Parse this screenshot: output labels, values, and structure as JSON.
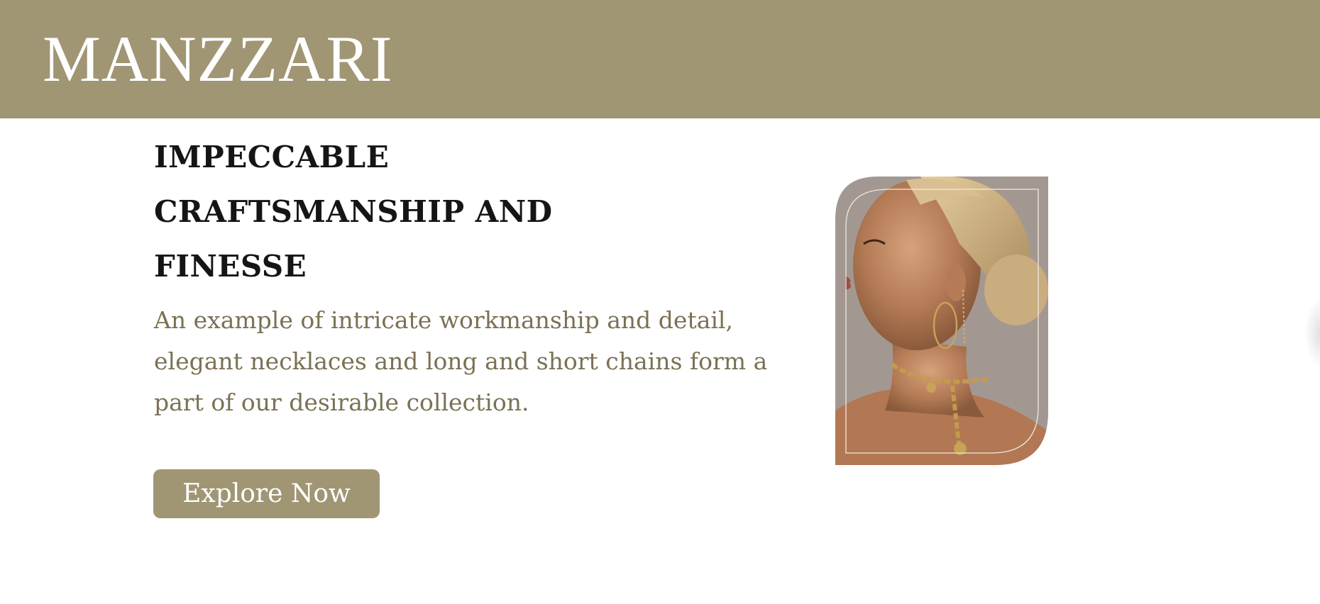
{
  "brand": {
    "logo_text": "MANZZARI",
    "header_color": "#a09674"
  },
  "hero": {
    "headline_lines": [
      "IMPECCABLE",
      "CRAFTSMANSHIP AND",
      "FINESSE"
    ],
    "description": "An example of intricate workmanship and detail, elegant necklaces and long and short chains form a part of our desirable collection.",
    "cta_label": "Explore Now",
    "image": {
      "subject": "woman wearing gold chain necklace and hoop earrings",
      "icon": "model-photo"
    }
  },
  "colors": {
    "accent": "#a09674",
    "headline": "#151515",
    "body_text": "#7b7154",
    "background": "#ffffff"
  }
}
